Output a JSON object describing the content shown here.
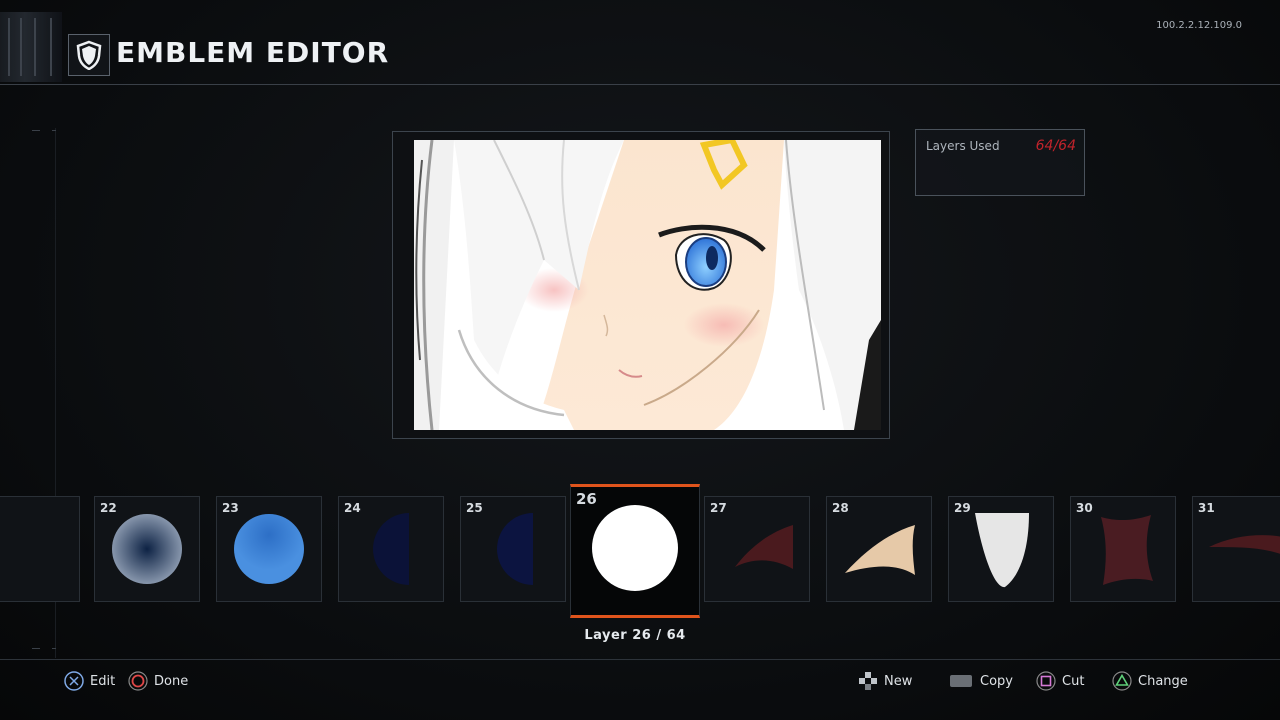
{
  "header": {
    "title": "EMBLEM EDITOR",
    "version": "100.2.2.12.109.0"
  },
  "layers_used": {
    "label": "Layers Used",
    "value": "64/64"
  },
  "layers": [
    {
      "num": "",
      "shape": "blank"
    },
    {
      "num": "22",
      "shape": "dark-blue-radial-circle"
    },
    {
      "num": "23",
      "shape": "blue-circle"
    },
    {
      "num": "24",
      "shape": "navy-half-circle"
    },
    {
      "num": "25",
      "shape": "navy-half-circle"
    },
    {
      "num": "26",
      "shape": "white-circle",
      "selected": true
    },
    {
      "num": "27",
      "shape": "dark-red-curve"
    },
    {
      "num": "28",
      "shape": "beige-horn"
    },
    {
      "num": "29",
      "shape": "white-shield"
    },
    {
      "num": "30",
      "shape": "red-curved-rect"
    },
    {
      "num": "31",
      "shape": "red-sweep"
    }
  ],
  "layer_label": "Layer 26 / 64",
  "footer": {
    "edit": "Edit",
    "done": "Done",
    "new": "New",
    "copy": "Copy",
    "cut": "Cut",
    "change": "Change"
  },
  "colors": {
    "accent": "#e0541c",
    "layers_full": "#c0232b"
  }
}
